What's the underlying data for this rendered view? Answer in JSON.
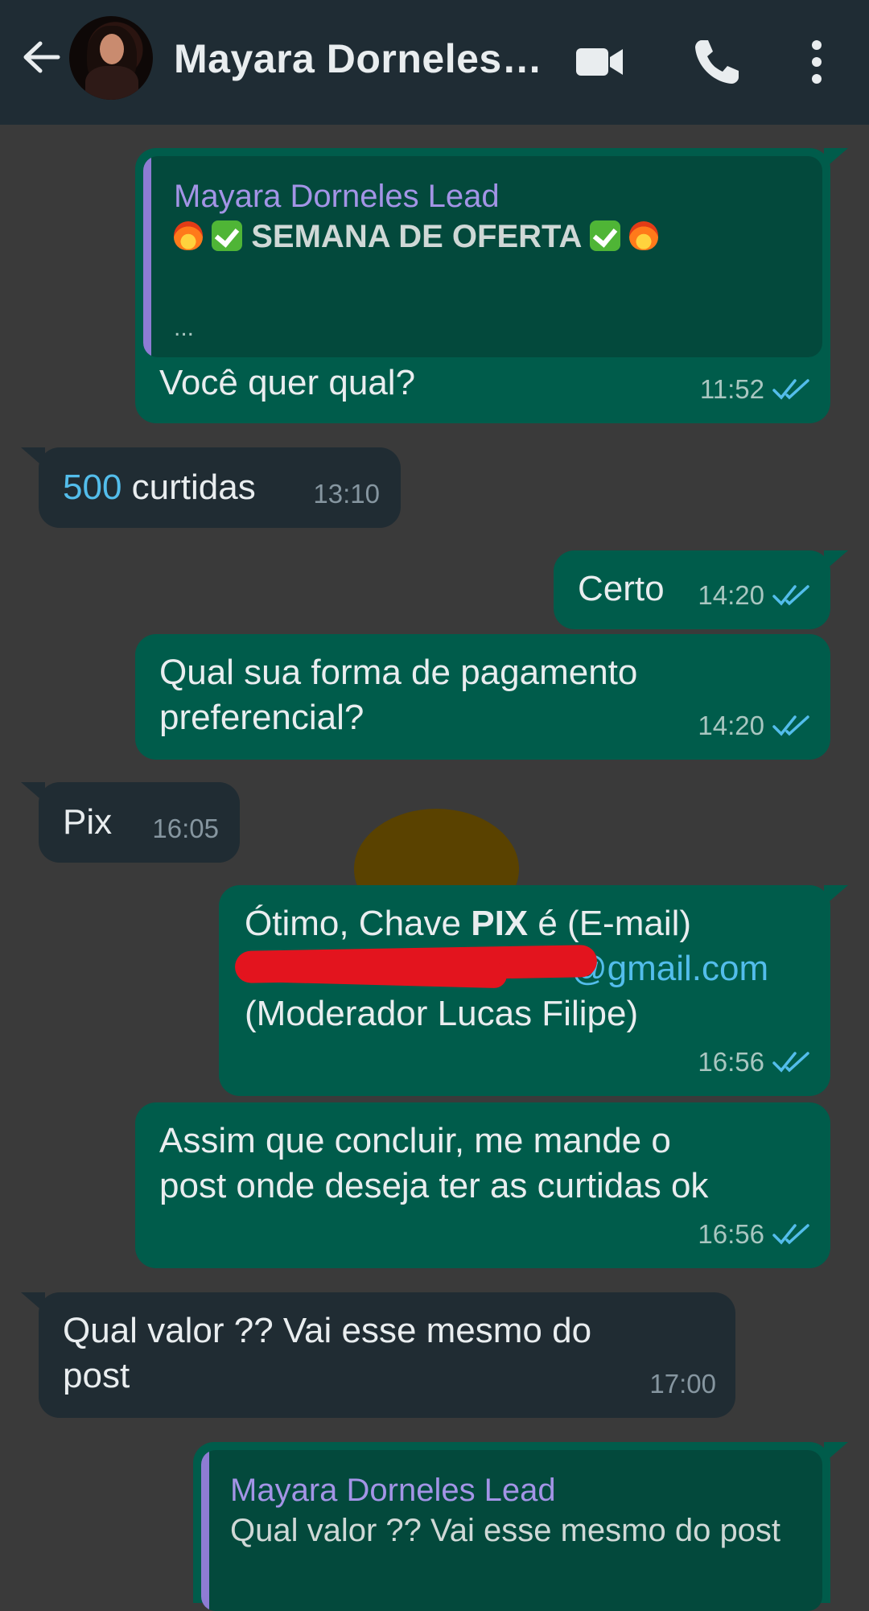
{
  "header": {
    "contact_name": "Mayara Dorneles…",
    "icons": [
      "back-arrow-icon",
      "video-call-icon",
      "phone-call-icon",
      "more-options-icon"
    ]
  },
  "messages": [
    {
      "direction": "out",
      "quote": {
        "author": "Mayara Dorneles Lead",
        "text": "SEMANA DE OFERTA",
        "ellipsis": "..."
      },
      "text": "Você quer qual?",
      "time": "11:52",
      "status": "read"
    },
    {
      "direction": "in",
      "text_highlight": "500",
      "text": "curtidas",
      "time": "13:10"
    },
    {
      "direction": "out",
      "text": "Certo",
      "time": "14:20",
      "status": "read"
    },
    {
      "direction": "out",
      "line1": "Qual sua forma de pagamento",
      "line2": "preferencial?",
      "time": "14:20",
      "status": "read"
    },
    {
      "direction": "in",
      "text": "Pix",
      "time": "16:05"
    },
    {
      "direction": "out",
      "line1_a": "Ótimo, Chave ",
      "line1_b": "PIX",
      "line1_c": " é (E-mail)",
      "email_visible": "@gmail.com",
      "line3": "(Moderador Lucas Filipe)",
      "time": "16:56",
      "status": "read"
    },
    {
      "direction": "out",
      "line1": "Assim que concluir, me mande o",
      "line2": "post onde deseja ter as curtidas ok",
      "time": "16:56",
      "status": "read"
    },
    {
      "direction": "in",
      "line1": "Qual valor ?? Vai esse mesmo do",
      "line2": "post",
      "time": "17:00"
    },
    {
      "direction": "out",
      "quote": {
        "author": "Mayara Dorneles Lead",
        "text": "Qual valor ?? Vai esse mesmo do post"
      }
    }
  ],
  "colors": {
    "background": "#3a3a3a",
    "header": "#1f2c34",
    "outgoing_bubble": "#005c4b",
    "incoming_bubble": "#202c33",
    "read_ticks": "#53bdeb",
    "quote_author": "#a394e6"
  }
}
